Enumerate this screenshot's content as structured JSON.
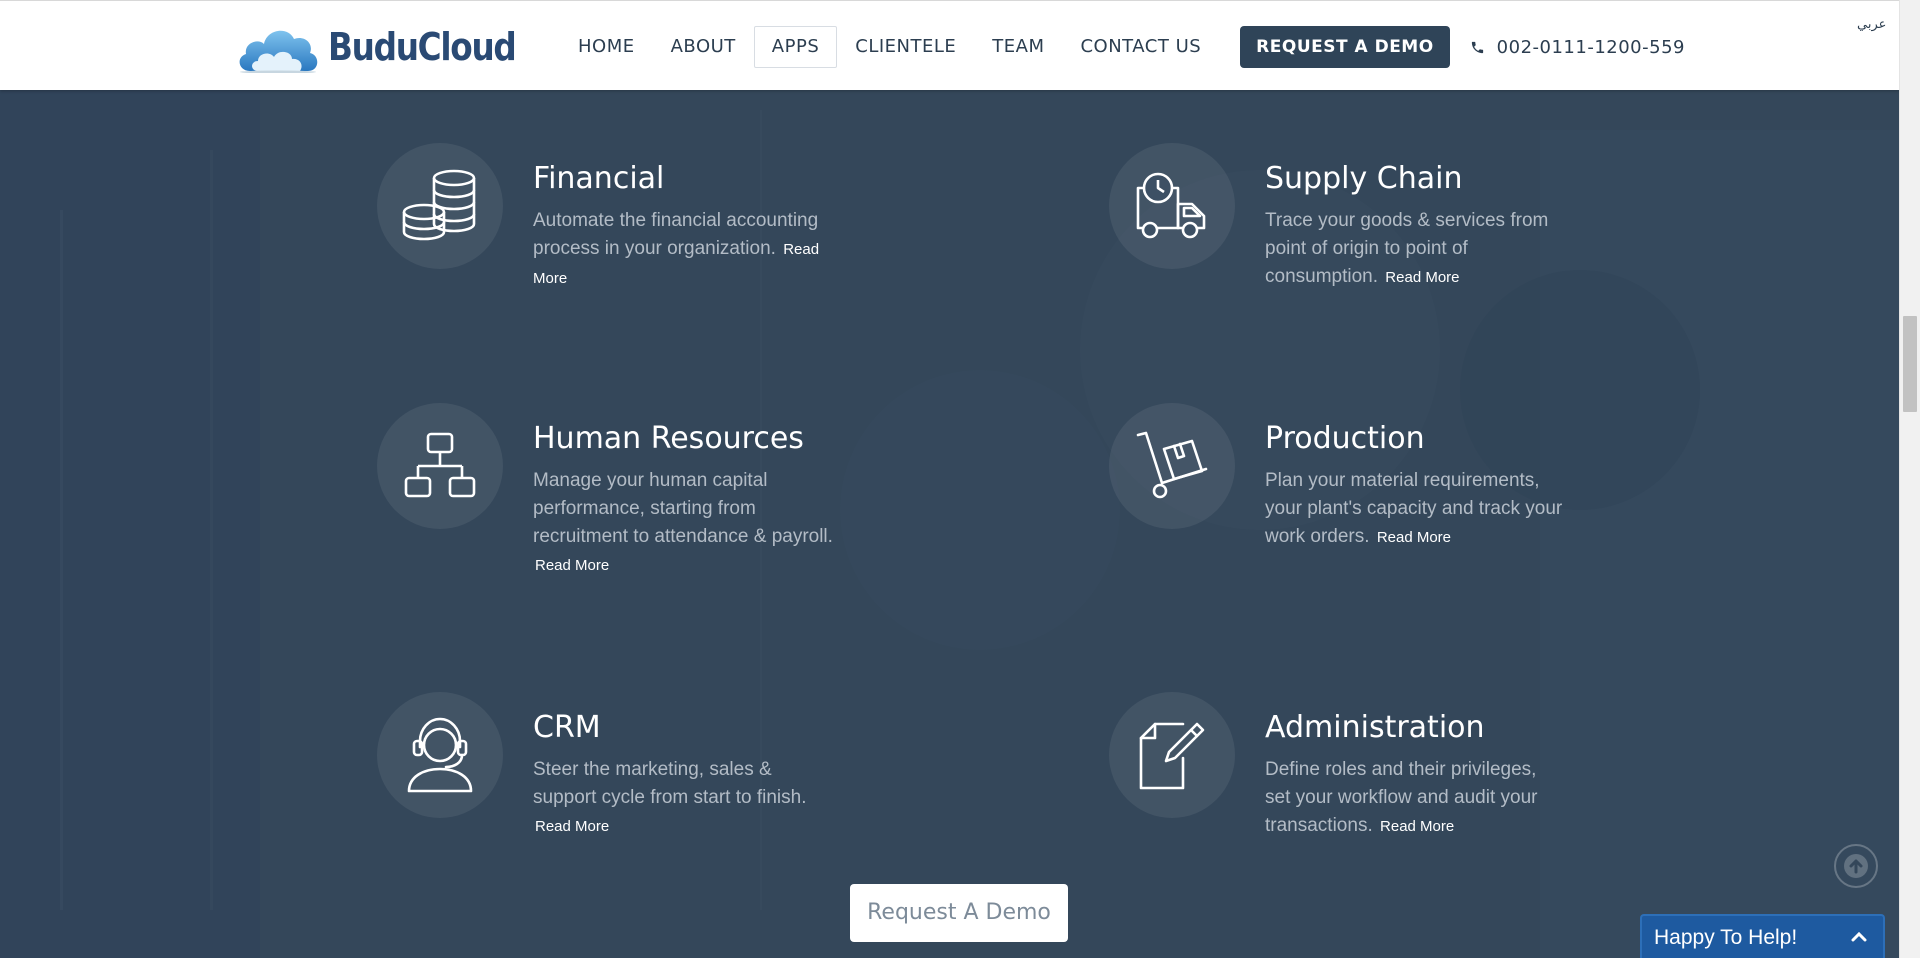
{
  "header": {
    "logo_text": "BuduCloud",
    "nav": [
      "HOME",
      "ABOUT",
      "APPS",
      "CLIENTELE",
      "TEAM",
      "CONTACT US"
    ],
    "active_nav": "APPS",
    "demo_button": "REQUEST A DEMO",
    "phone": "002-0111-1200-559",
    "language": "عربي"
  },
  "apps": [
    {
      "title": "Financial",
      "description": "Automate the financial accounting process in your organization.",
      "read_more": "Read More",
      "icon": "coins-stack-icon"
    },
    {
      "title": "Supply Chain",
      "description": "Trace your goods & services from point of origin to point of consumption.",
      "read_more": "Read More",
      "icon": "delivery-truck-icon"
    },
    {
      "title": "Human Resources",
      "description": "Manage your human capital performance, starting from recruitment to attendance & payroll.",
      "read_more": "Read More",
      "icon": "org-chart-icon"
    },
    {
      "title": "Production",
      "description": "Plan your material requirements, your plant's capacity and track your work orders.",
      "read_more": "Read More",
      "icon": "hand-truck-icon"
    },
    {
      "title": "CRM",
      "description": "Steer the marketing, sales & support cycle from start to finish.",
      "read_more": "Read More",
      "icon": "headset-agent-icon"
    },
    {
      "title": "Administration",
      "description": "Define roles and their privileges, set your workflow and audit your transactions.",
      "read_more": "Read More",
      "icon": "document-edit-icon"
    }
  ],
  "cta_button": "Request A Demo",
  "help_widget": "Happy To Help!",
  "colors": {
    "background": "#34475a",
    "header_bg": "#ffffff",
    "primary_dark": "#2f4458",
    "help_blue": "#1e5aa0"
  }
}
